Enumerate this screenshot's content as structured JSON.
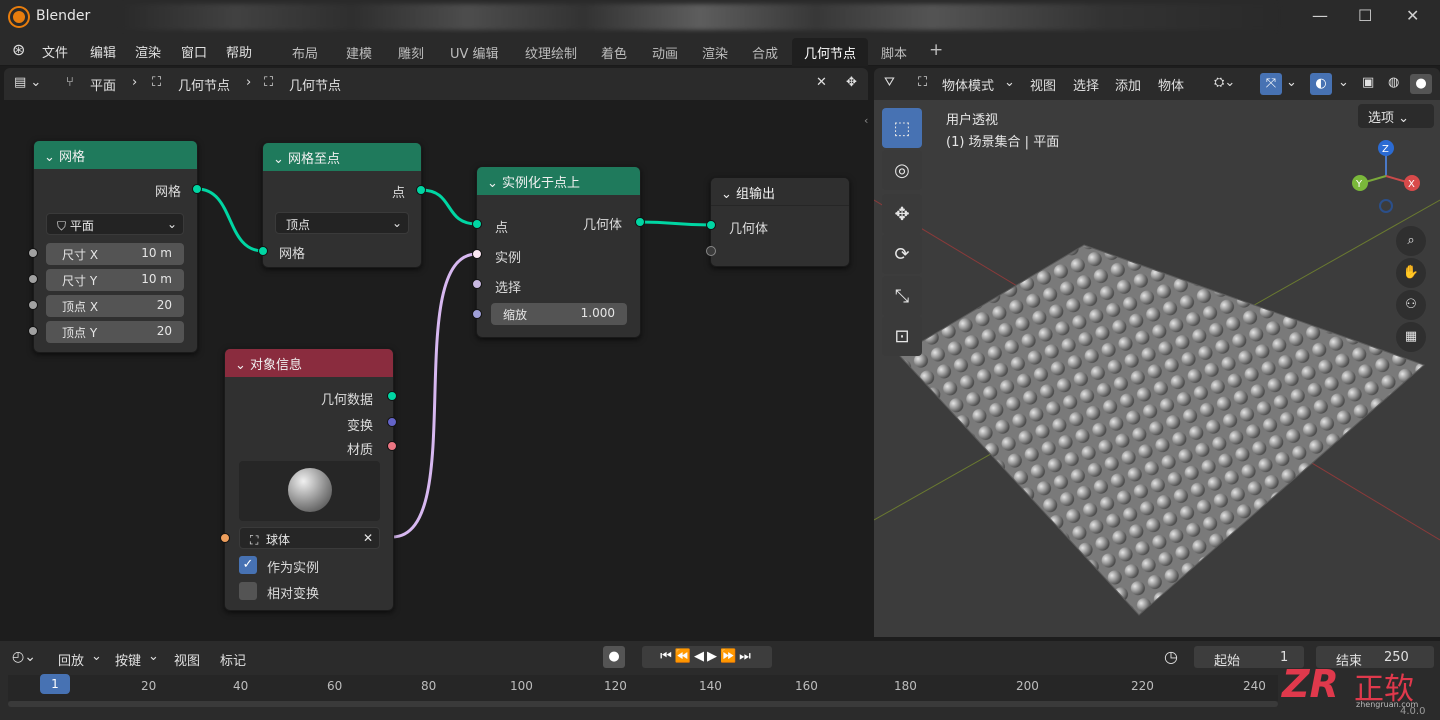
{
  "app": {
    "title": "Blender",
    "version": "4.0.0"
  },
  "menu": [
    "文件",
    "编辑",
    "渲染",
    "窗口",
    "帮助"
  ],
  "workspaces": [
    "布局",
    "建模",
    "雕刻",
    "UV 编辑",
    "纹理绘制",
    "着色",
    "动画",
    "渲染",
    "合成",
    "几何节点",
    "脚本"
  ],
  "active_workspace": "几何节点",
  "node_editor": {
    "breadcrumb": [
      "平面",
      "几何节点",
      "几何节点"
    ]
  },
  "nodes": {
    "grid": {
      "title": "网格",
      "output": "网格",
      "primitive": "平面",
      "sizex_label": "尺寸 X",
      "sizex": "10 m",
      "sizey_label": "尺寸 Y",
      "sizey": "10 m",
      "vx_label": "顶点 X",
      "vx": "20",
      "vy_label": "顶点 Y",
      "vy": "20"
    },
    "mesh_to_points": {
      "title": "网格至点",
      "output": "点",
      "mode": "顶点",
      "input": "网格"
    },
    "instance": {
      "title": "实例化于点上",
      "in_points": "点",
      "out_geometry": "几何体",
      "in_instance": "实例",
      "in_selection": "选择",
      "scale_label": "缩放",
      "scale": "1.000"
    },
    "group_output": {
      "title": "组输出",
      "input": "几何体"
    },
    "object_info": {
      "title": "对象信息",
      "out_geo": "几何数据",
      "out_transform": "变换",
      "out_material": "材质",
      "object": "球体",
      "as_instance": "作为实例",
      "relative": "相对变换"
    }
  },
  "viewport": {
    "mode": "物体模式",
    "menus": [
      "视图",
      "选择",
      "添加",
      "物体"
    ],
    "view_name": "用户透视",
    "collection": "(1) 场景集合 | 平面",
    "options": "选项",
    "axes": {
      "z": "Z",
      "x": "X",
      "y": "Y"
    }
  },
  "timeline": {
    "menus": [
      "回放",
      "按键",
      "视图",
      "标记"
    ],
    "current_frame": "1",
    "start_label": "起始",
    "start": "1",
    "end_label": "结束",
    "end": "250",
    "ticks": [
      "20",
      "40",
      "60",
      "80",
      "100",
      "120",
      "140",
      "160",
      "180",
      "200",
      "220",
      "240"
    ]
  },
  "watermark": {
    "logo": "ZR",
    "text": "正软",
    "url": "zhengruan.com"
  },
  "colors": {
    "geometry": "#00d6a3",
    "vector": "#6363c7",
    "float": "#a1a1a1",
    "material": "#eb7582",
    "object": "#ed9e5c",
    "instance": "#d7b8f0"
  }
}
